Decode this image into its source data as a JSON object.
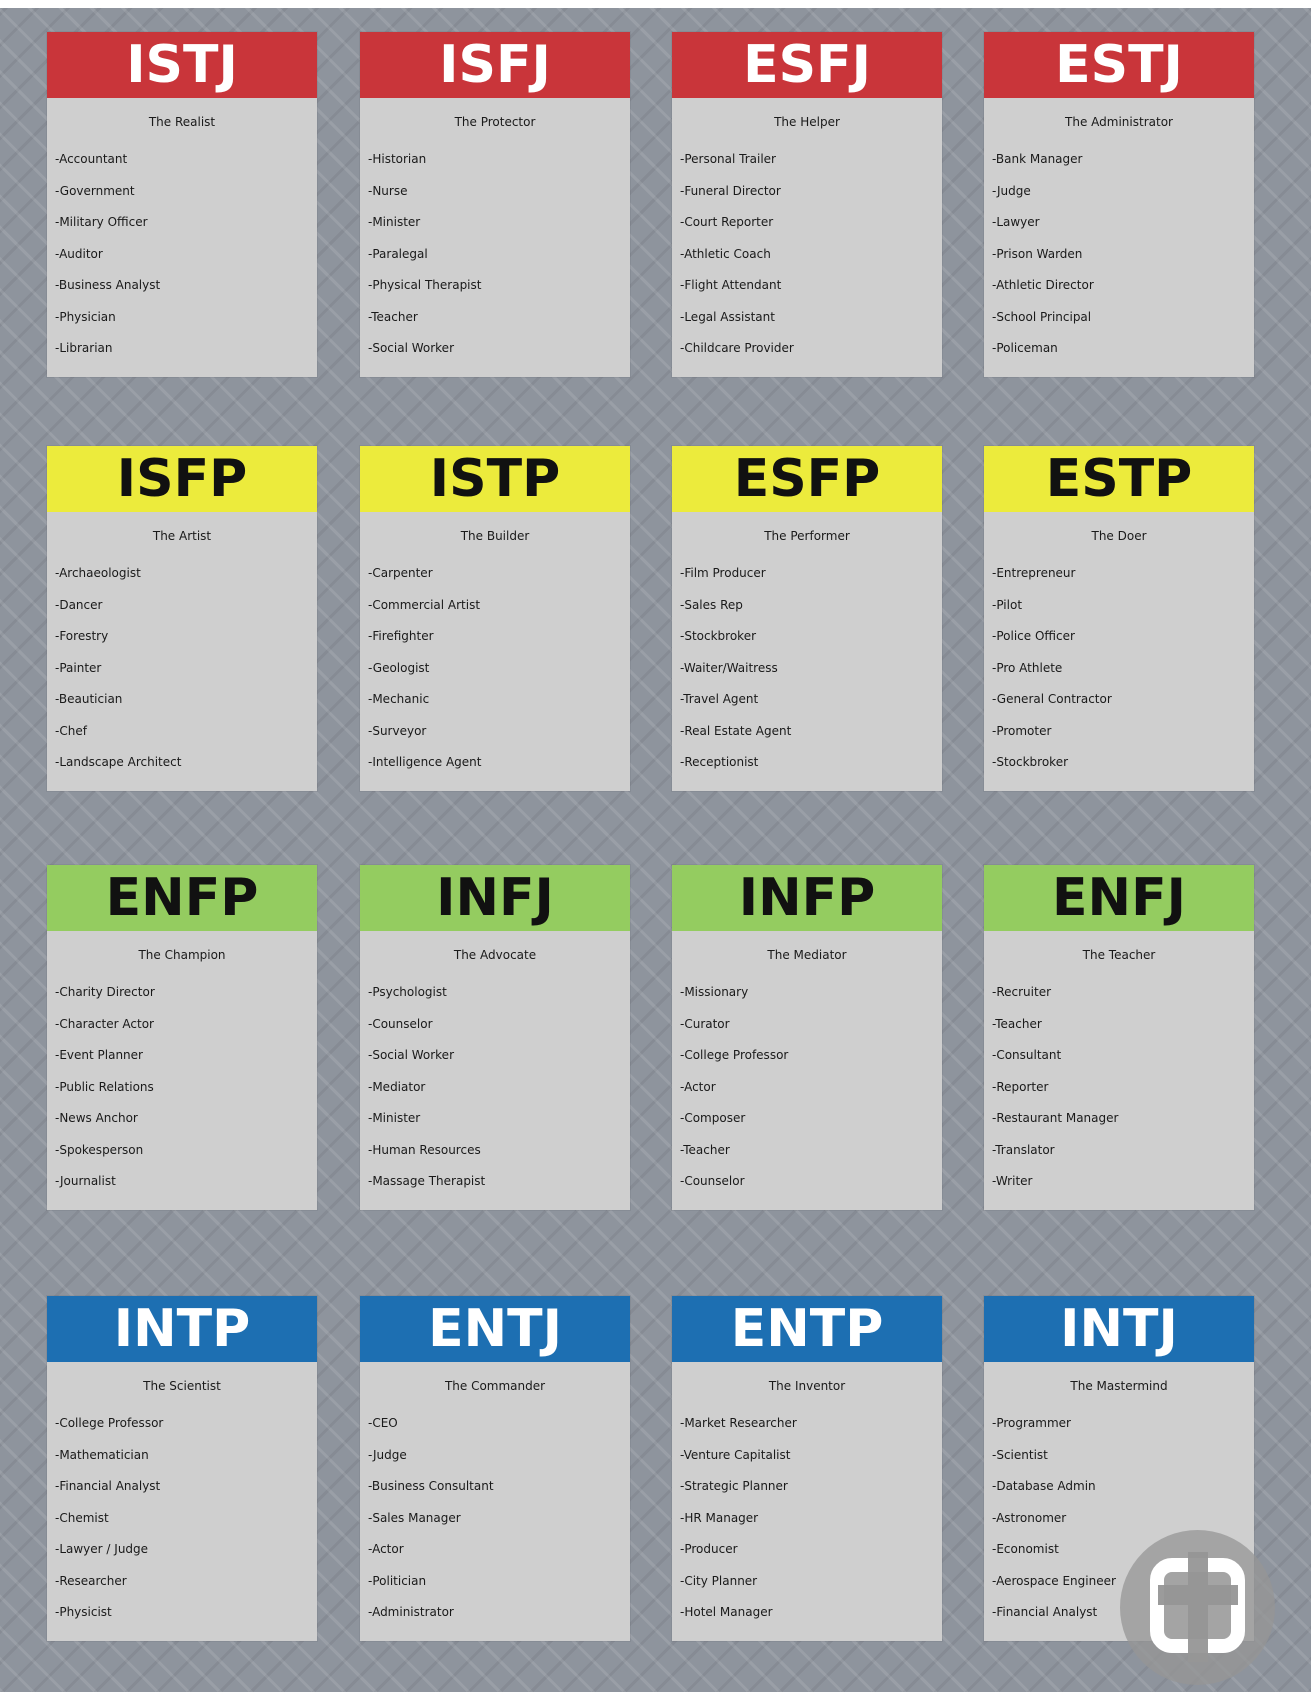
{
  "cards": [
    {
      "code": "ISTJ",
      "title": "The Realist",
      "careers": [
        "-Accountant",
        "-Government",
        "-Military Officer",
        "-Auditor",
        "-Business Analyst",
        "-Physician",
        "-Librarian"
      ]
    },
    {
      "code": "ISFJ",
      "title": "The Protector",
      "careers": [
        "-Historian",
        "-Nurse",
        "-Minister",
        "-Paralegal",
        "-Physical Therapist",
        "-Teacher",
        "-Social Worker"
      ]
    },
    {
      "code": "ESFJ",
      "title": "The Helper",
      "careers": [
        "-Personal Trailer",
        "-Funeral Director",
        "-Court Reporter",
        "-Athletic Coach",
        "-Flight Attendant",
        "-Legal Assistant",
        "-Childcare Provider"
      ]
    },
    {
      "code": "ESTJ",
      "title": "The Administrator",
      "careers": [
        "-Bank Manager",
        "-Judge",
        "-Lawyer",
        "-Prison Warden",
        "-Athletic Director",
        "-School Principal",
        "-Policeman"
      ]
    },
    {
      "code": "ISFP",
      "title": "The Artist",
      "careers": [
        "-Archaeologist",
        "-Dancer",
        "-Forestry",
        "-Painter",
        "-Beautician",
        "-Chef",
        "-Landscape Architect"
      ]
    },
    {
      "code": "ISTP",
      "title": "The Builder",
      "careers": [
        "-Carpenter",
        "-Commercial Artist",
        "-Firefighter",
        "-Geologist",
        "-Mechanic",
        "-Surveyor",
        "-Intelligence Agent"
      ]
    },
    {
      "code": "ESFP",
      "title": "The Performer",
      "careers": [
        "-Film Producer",
        "-Sales Rep",
        "-Stockbroker",
        "-Waiter/Waitress",
        "-Travel Agent",
        "-Real Estate Agent",
        "-Receptionist"
      ]
    },
    {
      "code": "ESTP",
      "title": "The Doer",
      "careers": [
        "-Entrepreneur",
        "-Pilot",
        "-Police Officer",
        "-Pro Athlete",
        "-General Contractor",
        "-Promoter",
        "-Stockbroker"
      ]
    },
    {
      "code": "ENFP",
      "title": "The Champion",
      "careers": [
        "-Charity Director",
        "-Character Actor",
        "-Event Planner",
        "-Public Relations",
        "-News Anchor",
        "-Spokesperson",
        "-Journalist"
      ]
    },
    {
      "code": "INFJ",
      "title": "The Advocate",
      "careers": [
        "-Psychologist",
        "-Counselor",
        "-Social Worker",
        "-Mediator",
        "-Minister",
        "-Human Resources",
        "-Massage Therapist"
      ]
    },
    {
      "code": "INFP",
      "title": "The Mediator",
      "careers": [
        "-Missionary",
        "-Curator",
        "-College Professor",
        "-Actor",
        "-Composer",
        "-Teacher",
        "-Counselor"
      ]
    },
    {
      "code": "ENFJ",
      "title": "The Teacher",
      "careers": [
        "-Recruiter",
        "-Teacher",
        "-Consultant",
        "-Reporter",
        "-Restaurant Manager",
        "-Translator",
        "-Writer"
      ]
    },
    {
      "code": "INTP",
      "title": "The Scientist",
      "careers": [
        "-College Professor",
        "-Mathematician",
        "-Financial Analyst",
        "-Chemist",
        "-Lawyer / Judge",
        "-Researcher",
        "-Physicist"
      ]
    },
    {
      "code": "ENTJ",
      "title": "The Commander",
      "careers": [
        "-CEO",
        "-Judge",
        "-Business Consultant",
        "-Sales Manager",
        "-Actor",
        "-Politician",
        "-Administrator"
      ]
    },
    {
      "code": "ENTP",
      "title": "The Inventor",
      "careers": [
        "-Market Researcher",
        "-Venture Capitalist",
        "-Strategic Planner",
        "-HR Manager",
        "-Producer",
        "-City Planner",
        "-Hotel Manager"
      ]
    },
    {
      "code": "INTJ",
      "title": "The Mastermind",
      "careers": [
        "-Programmer",
        "-Scientist",
        "-Database Admin",
        "-Astronomer",
        "-Economist",
        "-Aerospace Engineer",
        "-Financial Analyst"
      ]
    }
  ],
  "colors": {
    "red": "#c9353a",
    "yellow": "#eceb3c",
    "green": "#94cc60",
    "blue": "#1d6fb2",
    "card": "#cfcfcf",
    "background": "#8e949d"
  },
  "badge": {
    "icon": "lens-scan-icon"
  }
}
